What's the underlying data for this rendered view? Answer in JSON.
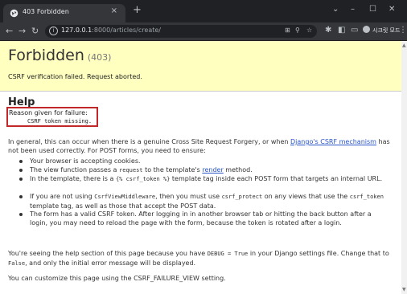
{
  "tab": {
    "title": "403 Forbidden",
    "close": "×"
  },
  "newtab": "+",
  "window": {
    "minimize": "–",
    "maximize": "☐",
    "close": "✕",
    "chevron": "⌄"
  },
  "toolbar": {
    "url_host": "127.0.0.1",
    "url_path": ":8000/articles/create/",
    "profile_label": "시크릿 모드"
  },
  "page": {
    "title": "Forbidden",
    "status_code": "(403)",
    "summary": "CSRF verification failed. Request aborted.",
    "help_heading": "Help",
    "reason_label": "Reason given for failure:",
    "reason_text": "CSRF token missing.",
    "intro_before": "In general, this can occur when there is a genuine Cross Site Request Forgery, or when ",
    "intro_link": "Django's CSRF mechanism",
    "intro_after": " has not been used correctly. For POST forms, you need to ensure:",
    "bullets": {
      "b1": "Your browser is accepting cookies.",
      "b2_a": "The view function passes a ",
      "b2_code": "request",
      "b2_b": " to the template's ",
      "b2_link": "render",
      "b2_c": " method.",
      "b3_a": "In the template, there is a ",
      "b3_code": "{% csrf_token %}",
      "b3_b": " template tag inside each POST form that targets an internal URL.",
      "b4_a": "If you are not using ",
      "b4_code1": "CsrfViewMiddleware",
      "b4_b": ", then you must use ",
      "b4_code2": "csrf_protect",
      "b4_c": " on any views that use the ",
      "b4_code3": "csrf_token",
      "b4_d": " template tag, as well as those that accept the POST data.",
      "b5": "The form has a valid CSRF token. After logging in in another browser tab or hitting the back button after a login, you may need to reload the page with the form, because the token is rotated after a login."
    },
    "debug_a": "You're seeing the help section of this page because you have ",
    "debug_code1": "DEBUG = True",
    "debug_b": " in your Django settings file. Change that to ",
    "debug_code2": "False",
    "debug_c": ", and only the initial error message will be displayed.",
    "custom": "You can customize this page using the CSRF_FAILURE_VIEW setting."
  }
}
